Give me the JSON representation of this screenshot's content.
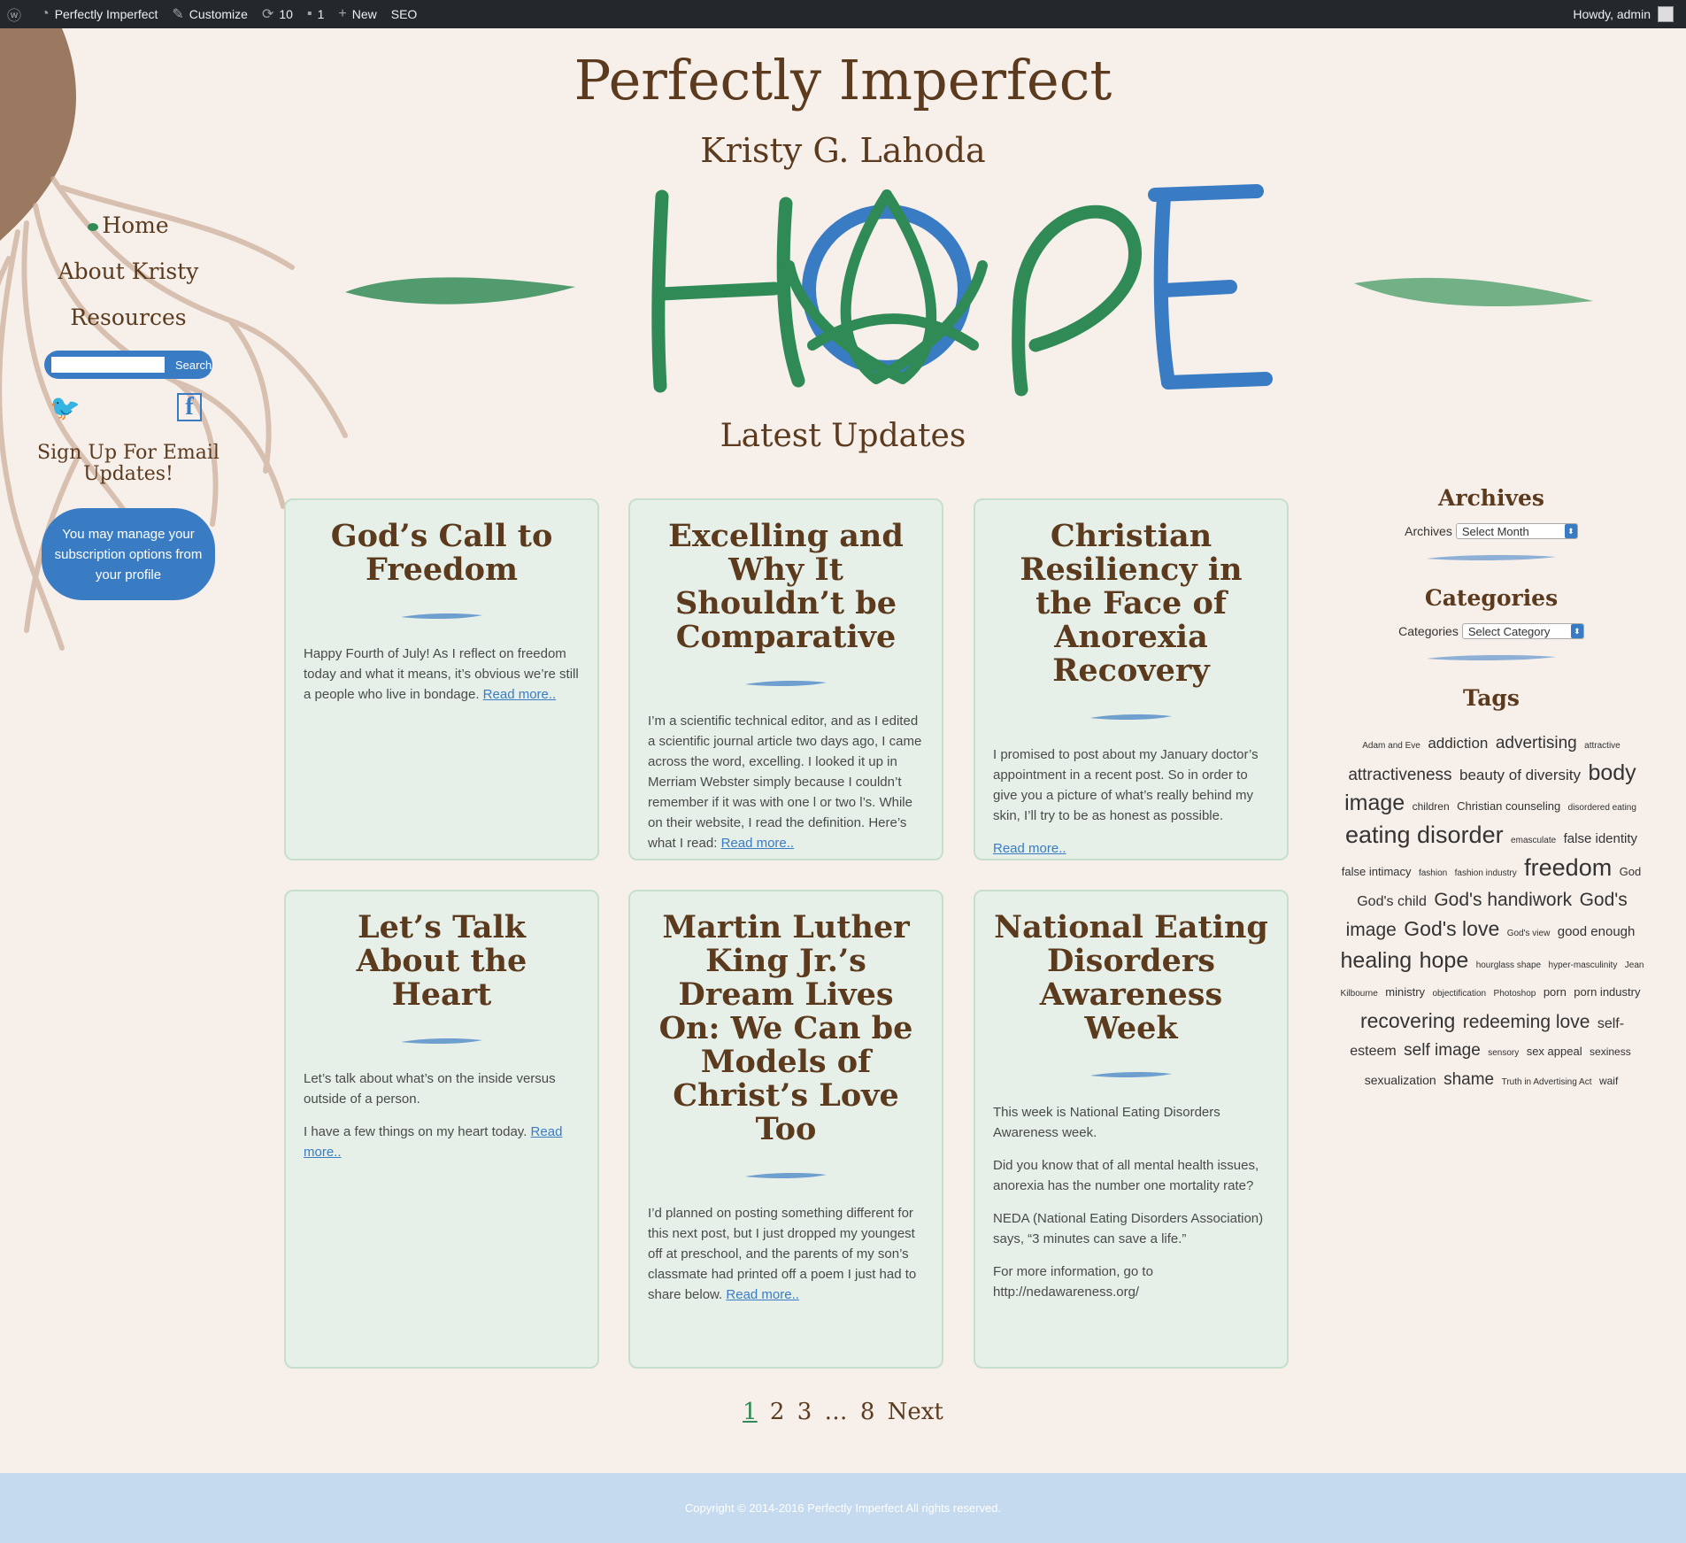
{
  "admin_bar": {
    "site_name": "Perfectly Imperfect",
    "customize": "Customize",
    "updates_count": "10",
    "comments_count": "1",
    "new_label": "New",
    "seo_label": "SEO",
    "howdy": "Howdy, admin"
  },
  "header": {
    "title": "Perfectly Imperfect",
    "subtitle": "Kristy G. Lahoda",
    "logo_text": "HOPE"
  },
  "left_nav": {
    "items": [
      "Home",
      "About Kristy",
      "Resources"
    ],
    "search_button": "Search",
    "signup_title": "Sign Up For Email Updates!",
    "manage_subscription": "You may manage your subscription options from your profile"
  },
  "main": {
    "section_title": "Latest Updates",
    "posts": [
      {
        "title": "God’s Call to Freedom",
        "paragraphs": [
          "Happy Fourth of July! As I reflect on freedom today and what it means, it’s obvious we’re still a people who live in bondage."
        ],
        "read_more": "Read more.."
      },
      {
        "title": "Excelling and Why It Shouldn’t be Comparative",
        "paragraphs": [
          "I’m a scientific technical editor, and as I edited a scientific journal article two days ago, I came across the word, excelling. I looked it up in Merriam Webster simply because I couldn’t remember if it was with one l or two l’s. While on their website, I read the definition. Here’s what I read:"
        ],
        "read_more": "Read more.."
      },
      {
        "title": "Christian Resiliency in the Face of Anorexia Recovery",
        "paragraphs": [
          "I promised to post about my January doctor’s appointment in a recent post. So in order to give you a picture of what’s really behind my skin, I’ll try to be as honest as possible."
        ],
        "read_more": "Read more.."
      },
      {
        "title": "Let’s Talk About the Heart",
        "paragraphs": [
          "Let’s talk about what’s on the inside versus outside of a person.",
          "I have a few things on my heart today."
        ],
        "read_more": "Read more.."
      },
      {
        "title": "Martin Luther King Jr.’s Dream Lives On: We Can be Models of Christ’s Love Too",
        "paragraphs": [
          "I’d planned on posting something different for this next post, but I just dropped my youngest off at preschool, and the parents of my son’s classmate had printed off a poem I just had to share below."
        ],
        "read_more": "Read more.."
      },
      {
        "title": "National Eating Disorders Awareness Week",
        "paragraphs": [
          "This week is National Eating Disorders Awareness week.",
          "Did you know that of all mental health issues, anorexia has the number one mortality rate?",
          "NEDA (National Eating Disorders Association) says, “3 minutes can save a life.”",
          "For more information, go to http://nedawareness.org/"
        ],
        "read_more": ""
      }
    ],
    "pagination": [
      "1",
      "2",
      "3",
      "…",
      "8",
      "Next"
    ]
  },
  "sidebar": {
    "archives_title": "Archives",
    "archives_label": "Archives",
    "archives_select": "Select Month",
    "categories_title": "Categories",
    "categories_label": "Categories",
    "categories_select": "Select Category",
    "tags_title": "Tags",
    "tags": [
      {
        "name": "Adam and Eve",
        "size": 10
      },
      {
        "name": "addiction",
        "size": 17
      },
      {
        "name": "advertising",
        "size": 19
      },
      {
        "name": "attractive",
        "size": 10
      },
      {
        "name": "attractiveness",
        "size": 19
      },
      {
        "name": "beauty of diversity",
        "size": 17
      },
      {
        "name": "body image",
        "size": 25
      },
      {
        "name": "children",
        "size": 12
      },
      {
        "name": "Christian counseling",
        "size": 13
      },
      {
        "name": "disordered eating",
        "size": 10
      },
      {
        "name": "eating disorder",
        "size": 27
      },
      {
        "name": "emasculate",
        "size": 10
      },
      {
        "name": "false identity",
        "size": 15
      },
      {
        "name": "false intimacy",
        "size": 13
      },
      {
        "name": "fashion",
        "size": 10
      },
      {
        "name": "fashion industry",
        "size": 10
      },
      {
        "name": "freedom",
        "size": 27
      },
      {
        "name": "God",
        "size": 13
      },
      {
        "name": "God's child",
        "size": 16
      },
      {
        "name": "God's handiwork",
        "size": 21
      },
      {
        "name": "God's image",
        "size": 21
      },
      {
        "name": "God's love",
        "size": 23
      },
      {
        "name": "God's view",
        "size": 10
      },
      {
        "name": "good enough",
        "size": 15
      },
      {
        "name": "healing",
        "size": 25
      },
      {
        "name": "hope",
        "size": 25
      },
      {
        "name": "hourglass shape",
        "size": 10
      },
      {
        "name": "hyper-masculinity",
        "size": 10
      },
      {
        "name": "Jean Kilbourne",
        "size": 10
      },
      {
        "name": "ministry",
        "size": 13
      },
      {
        "name": "objectification",
        "size": 10
      },
      {
        "name": "Photoshop",
        "size": 10
      },
      {
        "name": "porn",
        "size": 13
      },
      {
        "name": "porn industry",
        "size": 13
      },
      {
        "name": "recovering",
        "size": 23
      },
      {
        "name": "redeeming love",
        "size": 21
      },
      {
        "name": "self-esteem",
        "size": 16
      },
      {
        "name": "self image",
        "size": 19
      },
      {
        "name": "sensory",
        "size": 10
      },
      {
        "name": "sex appeal",
        "size": 13
      },
      {
        "name": "sexiness",
        "size": 12
      },
      {
        "name": "sexualization",
        "size": 14
      },
      {
        "name": "shame",
        "size": 19
      },
      {
        "name": "Truth in Advertising Act",
        "size": 10
      },
      {
        "name": "waif",
        "size": 12
      }
    ]
  },
  "footer": {
    "copyright": "Copyright © 2014-2016 Perfectly Imperfect All rights reserved."
  },
  "colors": {
    "brown": "#5b3a1e",
    "green": "#2f8a55",
    "blue": "#3a7cc4",
    "card_bg": "#e6f0e8",
    "footer_bg": "#c5daee",
    "admin_bar": "#23282d"
  }
}
